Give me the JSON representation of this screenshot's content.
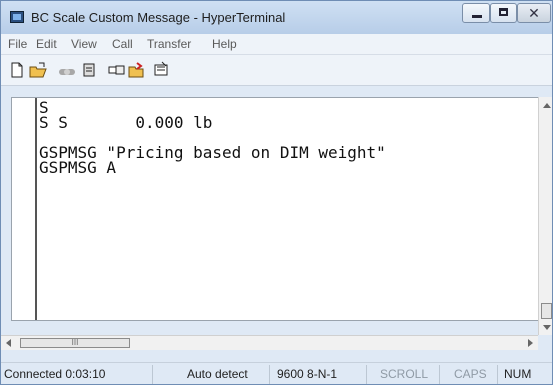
{
  "window": {
    "title": "BC Scale Custom Message - HyperTerminal",
    "buttons": {
      "minimize_icon": "minimize-icon",
      "maximize_icon": "maximize-icon",
      "close_icon": "close-icon"
    }
  },
  "menu": {
    "items": [
      "File",
      "Edit",
      "View",
      "Call",
      "Transfer",
      "Help"
    ]
  },
  "toolbar": {
    "icons": [
      "new-icon",
      "open-icon",
      "disconnect-icon",
      "dial-icon",
      "send-icon",
      "receive-icon",
      "properties-icon"
    ]
  },
  "terminal": {
    "text": "S\nS S       0.000 lb\n\nGSPMSG \"Pricing based on DIM weight\"\nGSPMSG A"
  },
  "status": {
    "connected": "Connected 0:03:10",
    "detect": "Auto detect",
    "settings": "9600 8-N-1",
    "scroll": "SCROLL",
    "caps": "CAPS",
    "num": "NUM"
  },
  "scrollbars": {
    "h_thumb_label": "III"
  }
}
